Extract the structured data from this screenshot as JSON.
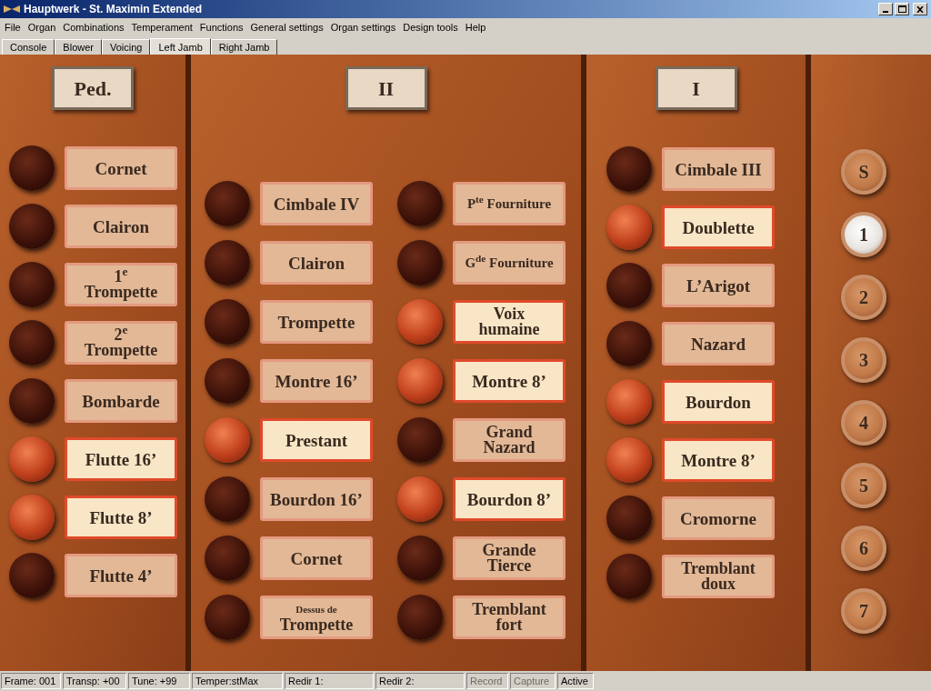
{
  "window": {
    "title": "Hauptwerk - St. Maximin Extended"
  },
  "menu": [
    "File",
    "Organ",
    "Combinations",
    "Temperament",
    "Functions",
    "General settings",
    "Organ settings",
    "Design tools",
    "Help"
  ],
  "tabs": [
    {
      "label": "Console",
      "selected": false
    },
    {
      "label": "Blower",
      "selected": false
    },
    {
      "label": "Voicing",
      "selected": false
    },
    {
      "label": "Left Jamb",
      "selected": true
    },
    {
      "label": "Right Jamb",
      "selected": false
    }
  ],
  "divisions": [
    {
      "title": "Ped.",
      "columns": [
        [
          {
            "lines": [
              "Cornet"
            ],
            "on": false
          },
          {
            "lines": [
              "Clairon"
            ],
            "on": false
          },
          {
            "lines": [
              "1$^{e}$",
              "Trompette"
            ],
            "on": false
          },
          {
            "lines": [
              "2$^{e}$",
              "Trompette"
            ],
            "on": false
          },
          {
            "lines": [
              "Bombarde"
            ],
            "on": false
          },
          {
            "lines": [
              "Flutte 16’"
            ],
            "on": true
          },
          {
            "lines": [
              "Flutte 8’"
            ],
            "on": true
          },
          {
            "lines": [
              "Flutte 4’"
            ],
            "on": false
          }
        ]
      ]
    },
    {
      "title": "II",
      "columns": [
        [
          {
            "lines": [
              "Cimbale IV"
            ],
            "on": false
          },
          {
            "lines": [
              "Clairon"
            ],
            "on": false
          },
          {
            "lines": [
              "Trompette"
            ],
            "on": false
          },
          {
            "lines": [
              "Montre 16’"
            ],
            "on": false
          },
          {
            "lines": [
              "Prestant"
            ],
            "on": true
          },
          {
            "lines": [
              "Bourdon 16’"
            ],
            "on": false
          },
          {
            "lines": [
              "Cornet"
            ],
            "on": false
          },
          {
            "lines": [
              "Dessus de",
              "Trompette"
            ],
            "on": false,
            "small_first": true
          }
        ],
        [
          {
            "lines": [
              "P$^{te}$ Fourniture"
            ],
            "on": false,
            "compact": true
          },
          {
            "lines": [
              "G$^{de}$ Fourniture"
            ],
            "on": false,
            "compact": true
          },
          {
            "lines": [
              "Voix",
              "humaine"
            ],
            "on": true
          },
          {
            "lines": [
              "Montre 8’"
            ],
            "on": true
          },
          {
            "lines": [
              "Grand",
              "Nazard"
            ],
            "on": false
          },
          {
            "lines": [
              "Bourdon 8’"
            ],
            "on": true
          },
          {
            "lines": [
              "Grande",
              "Tierce"
            ],
            "on": false
          },
          {
            "lines": [
              "Tremblant",
              "fort"
            ],
            "on": false
          }
        ]
      ]
    },
    {
      "title": "I",
      "columns": [
        [
          {
            "lines": [
              "Cimbale III"
            ],
            "on": false
          },
          {
            "lines": [
              "Doublette"
            ],
            "on": true
          },
          {
            "lines": [
              "L’Arigot"
            ],
            "on": false
          },
          {
            "lines": [
              "Nazard"
            ],
            "on": false
          },
          {
            "lines": [
              "Bourdon"
            ],
            "on": true
          },
          {
            "lines": [
              "Montre 8’"
            ],
            "on": true
          },
          {
            "lines": [
              "Cromorne"
            ],
            "on": false
          },
          {
            "lines": [
              "Tremblant",
              "doux"
            ],
            "on": false
          }
        ]
      ]
    }
  ],
  "combinations": [
    {
      "label": "S",
      "selected": false
    },
    {
      "label": "1",
      "selected": true
    },
    {
      "label": "2",
      "selected": false
    },
    {
      "label": "3",
      "selected": false
    },
    {
      "label": "4",
      "selected": false
    },
    {
      "label": "5",
      "selected": false
    },
    {
      "label": "6",
      "selected": false
    },
    {
      "label": "7",
      "selected": false
    }
  ],
  "status_bar": [
    {
      "text": "Frame: 001",
      "disabled": false
    },
    {
      "text": "Transp: +00",
      "disabled": false
    },
    {
      "text": "Tune: +99",
      "disabled": false
    },
    {
      "text": "Temper:stMax",
      "disabled": false
    },
    {
      "text": "Redir 1:",
      "disabled": false
    },
    {
      "text": "Redir 2:",
      "disabled": false
    },
    {
      "text": "Record",
      "disabled": true
    },
    {
      "text": "Capture",
      "disabled": true
    },
    {
      "text": "Active",
      "disabled": false
    }
  ]
}
